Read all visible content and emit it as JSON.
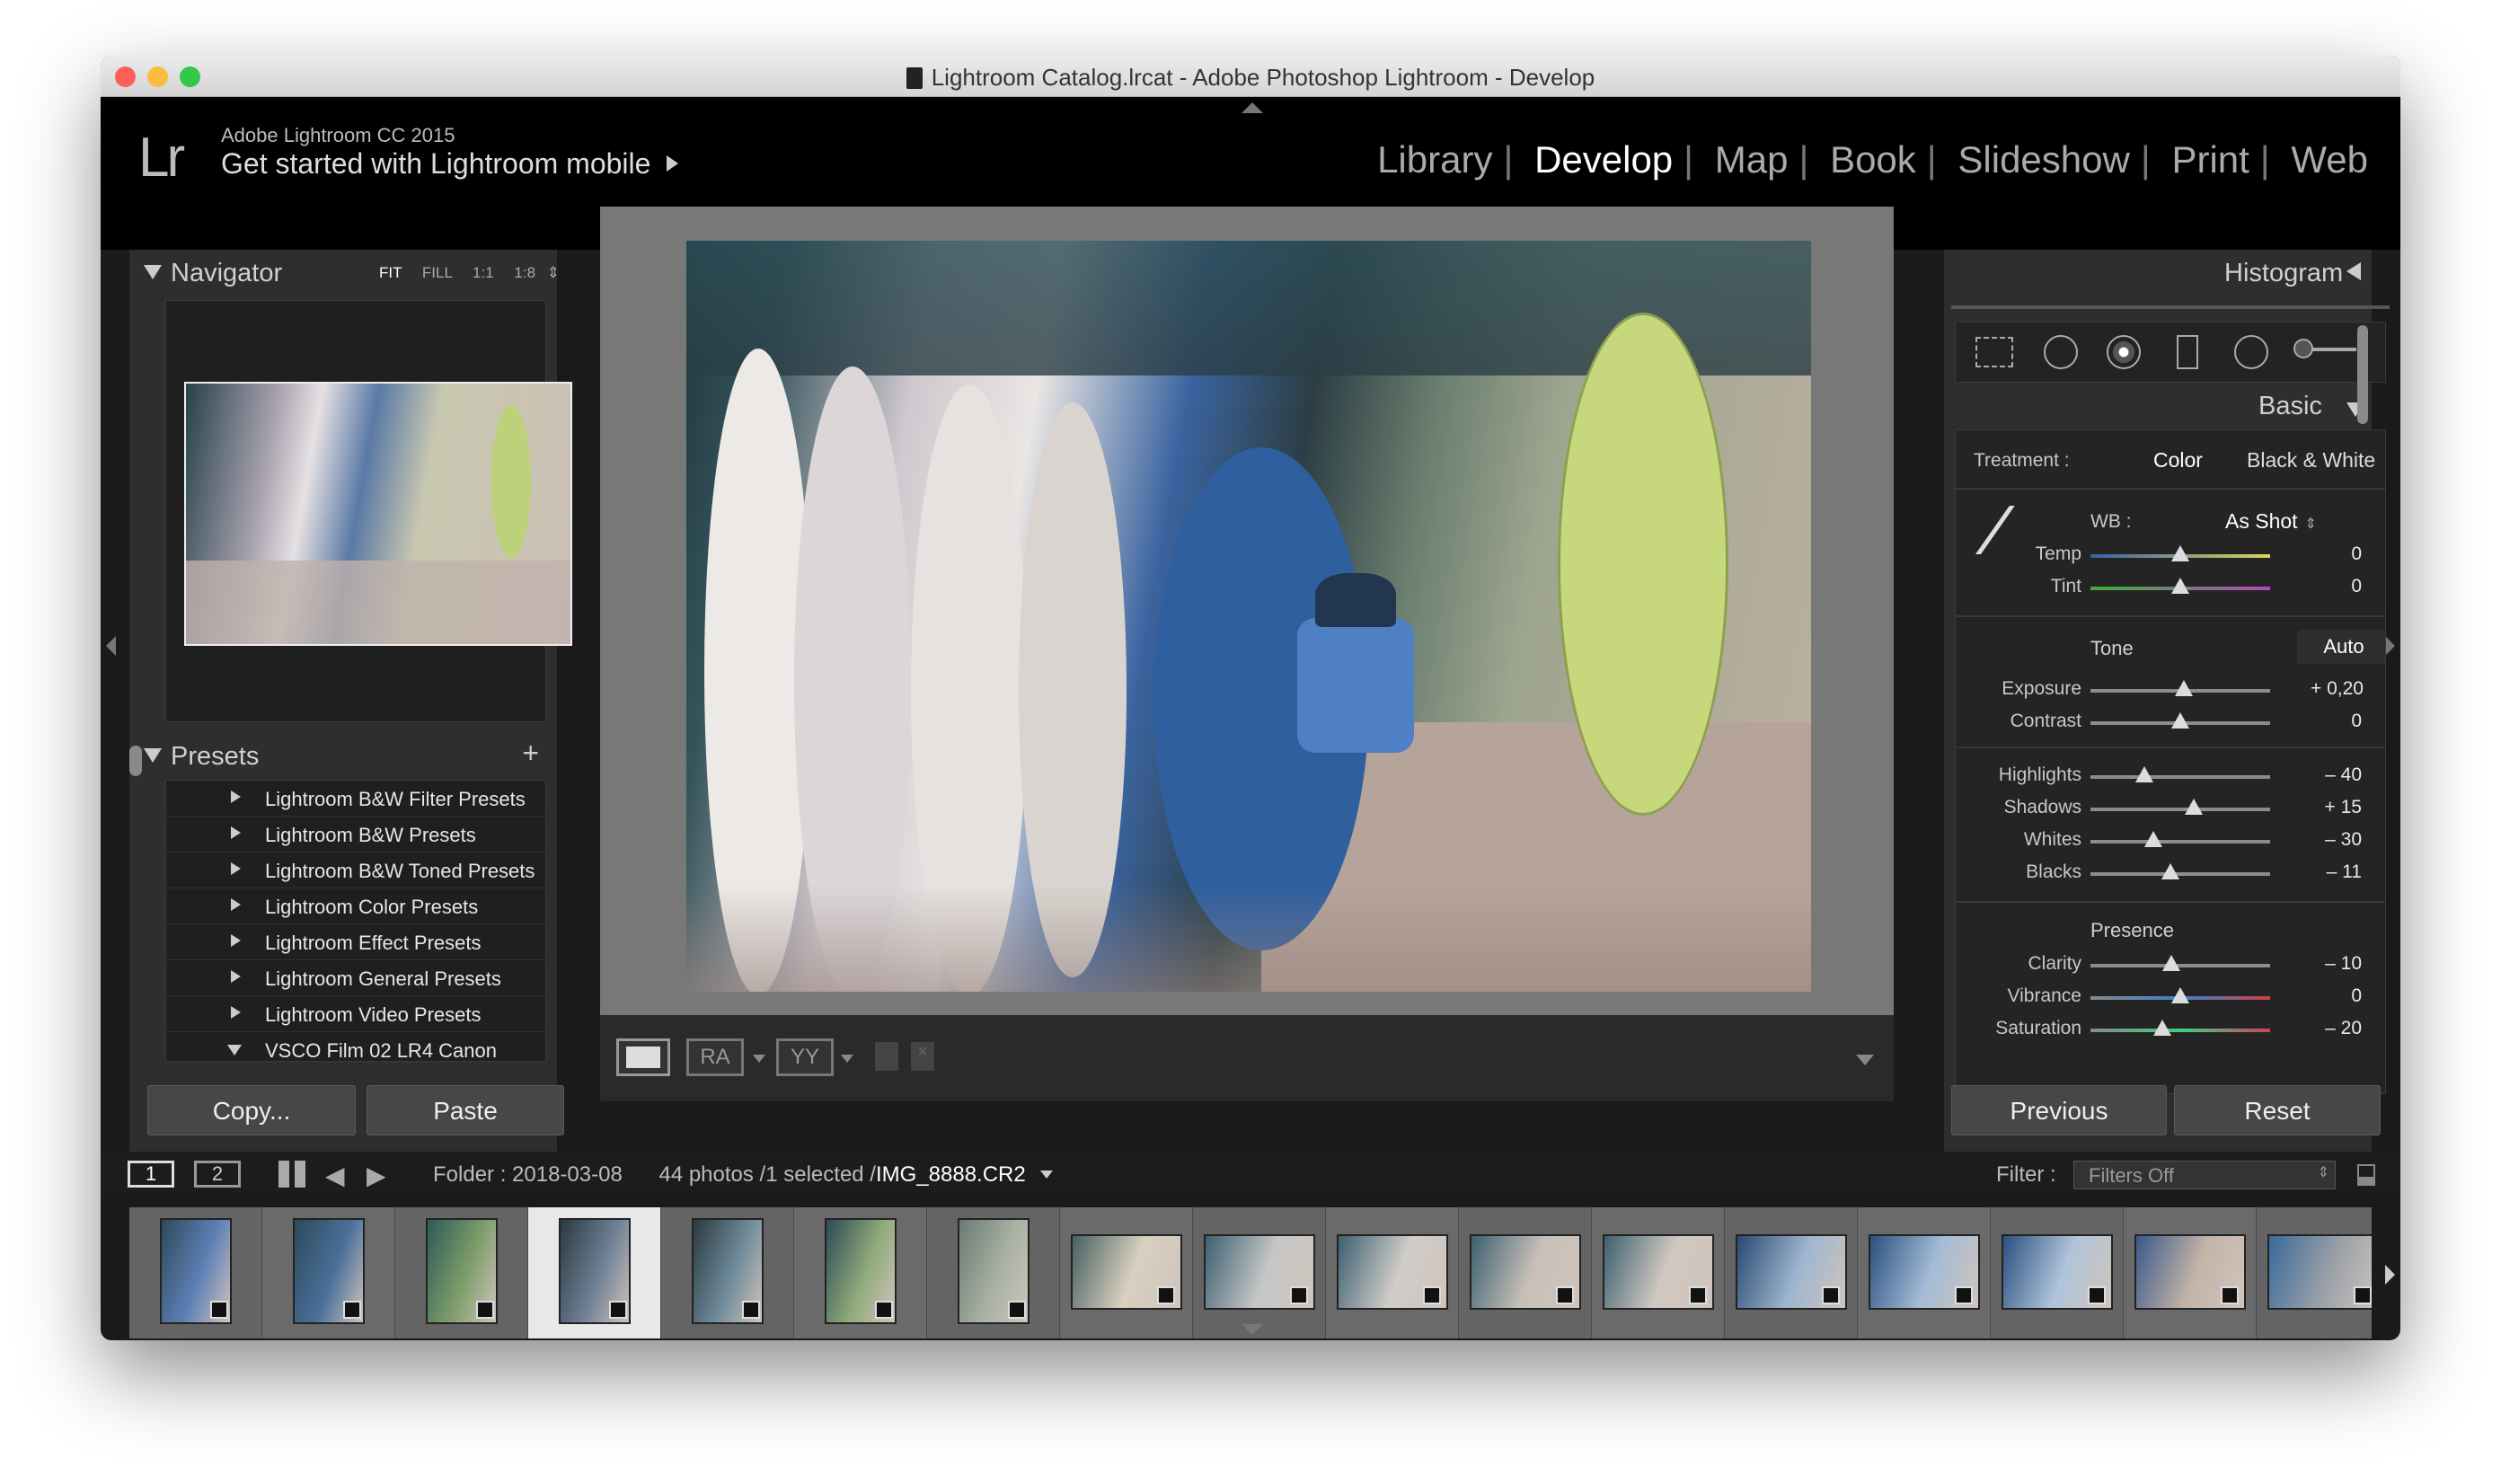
{
  "window": {
    "title": "Lightroom Catalog.lrcat - Adobe Photoshop Lightroom - Develop"
  },
  "identity": {
    "logo": "Lr",
    "version": "Adobe Lightroom CC 2015",
    "mobile_link": "Get started with Lightroom mobile"
  },
  "modules": [
    {
      "label": "Library",
      "active": false
    },
    {
      "label": "Develop",
      "active": true
    },
    {
      "label": "Map",
      "active": false
    },
    {
      "label": "Book",
      "active": false
    },
    {
      "label": "Slideshow",
      "active": false
    },
    {
      "label": "Print",
      "active": false
    },
    {
      "label": "Web",
      "active": false
    }
  ],
  "left_panel": {
    "navigator": {
      "title": "Navigator",
      "zoom_options": [
        "FIT",
        "FILL",
        "1:1",
        "1:8"
      ]
    },
    "presets": {
      "title": "Presets",
      "items": [
        "Lightroom B&W Filter Presets",
        "Lightroom B&W Presets",
        "Lightroom B&W Toned Presets",
        "Lightroom Color Presets",
        "Lightroom Effect Presets",
        "Lightroom General Presets",
        "Lightroom Video Presets",
        "VSCO Film 02 LR4 Canon"
      ]
    },
    "copy_label": "Copy...",
    "paste_label": "Paste"
  },
  "right_panel": {
    "histogram_title": "Histogram",
    "basic_title": "Basic",
    "treatment_label": "Treatment :",
    "treatment_color": "Color",
    "treatment_bw": "Black & White",
    "wb_label": "WB :",
    "wb_value": "As Shot",
    "temp": {
      "label": "Temp",
      "value": "0",
      "pos": 0.5
    },
    "tint": {
      "label": "Tint",
      "value": "0",
      "pos": 0.5
    },
    "tone_title": "Tone",
    "auto_label": "Auto",
    "exposure": {
      "label": "Exposure",
      "value": "+ 0,20",
      "pos": 0.52
    },
    "contrast": {
      "label": "Contrast",
      "value": "0",
      "pos": 0.5
    },
    "highlights": {
      "label": "Highlights",
      "value": "– 40",
      "pos": 0.3
    },
    "shadows": {
      "label": "Shadows",
      "value": "+ 15",
      "pos": 0.575
    },
    "whites": {
      "label": "Whites",
      "value": "– 30",
      "pos": 0.35
    },
    "blacks": {
      "label": "Blacks",
      "value": "– 11",
      "pos": 0.445
    },
    "presence_title": "Presence",
    "clarity": {
      "label": "Clarity",
      "value": "– 10",
      "pos": 0.45
    },
    "vibrance": {
      "label": "Vibrance",
      "value": "0",
      "pos": 0.5
    },
    "saturation": {
      "label": "Saturation",
      "value": "– 20",
      "pos": 0.4
    },
    "previous_label": "Previous",
    "reset_label": "Reset"
  },
  "filmstrip": {
    "screen1": "1",
    "screen2": "2",
    "folder": "Folder : 2018-03-08",
    "count": "44 photos /1 selected /",
    "selected_file": "IMG_8888.CR2",
    "filter_label": "Filter :",
    "filter_value": "Filters Off"
  },
  "toolbar": {
    "ra_label": "RA",
    "yy_label": "YY"
  }
}
